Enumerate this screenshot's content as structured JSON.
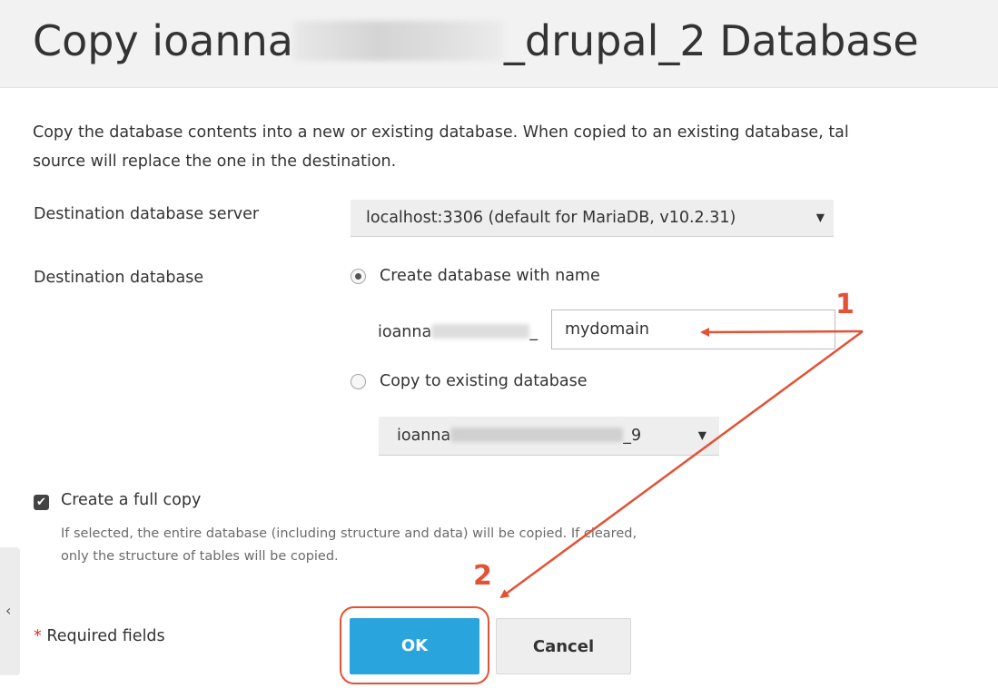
{
  "header": {
    "title_prefix": "Copy ioanna",
    "title_suffix": "_drupal_2 Database"
  },
  "intro": {
    "line1": "Copy the database contents into a new or existing database. When copied to an existing database, tal",
    "line2": "source will replace the one in the destination."
  },
  "server": {
    "label": "Destination database server",
    "value": "localhost:3306 (default for MariaDB, v10.2.31)"
  },
  "destination": {
    "label": "Destination database",
    "option_create": "Create database with name",
    "option_create_selected": true,
    "name_prefix_start": "ioanna",
    "name_prefix_end": "_",
    "name_value": "mydomain",
    "option_existing": "Copy to existing database",
    "existing_prefix": "ioanna",
    "existing_suffix": "_9"
  },
  "full_copy": {
    "checked": true,
    "label": "Create a full copy",
    "hint_line1": "If selected, the entire database (including structure and data) will be copied. If cleared,",
    "hint_line2": "only the structure of tables will be copied."
  },
  "footer": {
    "required_star": "*",
    "required_label": "Required fields",
    "ok_label": "OK",
    "cancel_label": "Cancel"
  },
  "annotations": {
    "step1": "1",
    "step2": "2",
    "color": "#e35235"
  },
  "icons": {
    "caret": "caret-down-icon",
    "side_chevron": "chevron-left-icon",
    "checkmark": "checkmark-icon"
  }
}
